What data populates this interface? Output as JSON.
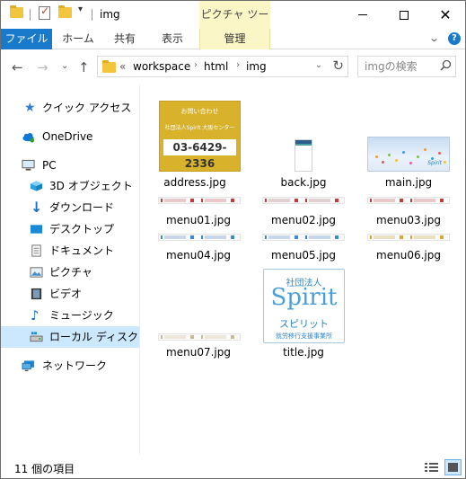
{
  "window": {
    "title": "img",
    "context_tab_header": "ピクチャ ツール"
  },
  "ribbon": {
    "tabs": [
      {
        "label": "ファイル"
      },
      {
        "label": "ホーム"
      },
      {
        "label": "共有"
      },
      {
        "label": "表示"
      },
      {
        "label": "管理"
      }
    ],
    "accent_color": "#1979ca",
    "context_color": "#fbf6c6"
  },
  "address": {
    "overflow": "«",
    "crumbs": [
      "workspace",
      "html",
      "img"
    ],
    "search_placeholder": "imgの検索"
  },
  "navpane": {
    "items": [
      {
        "label": "クイック アクセス",
        "icon": "star-icon"
      },
      {
        "label": "OneDrive",
        "icon": "cloud-icon"
      },
      {
        "label": "PC",
        "icon": "computer-icon"
      },
      {
        "label": "3D オブジェクト",
        "icon": "cube-icon"
      },
      {
        "label": "ダウンロード",
        "icon": "download-icon"
      },
      {
        "label": "デスクトップ",
        "icon": "desktop-icon"
      },
      {
        "label": "ドキュメント",
        "icon": "document-icon"
      },
      {
        "label": "ピクチャ",
        "icon": "picture-icon"
      },
      {
        "label": "ビデオ",
        "icon": "video-icon"
      },
      {
        "label": "ミュージック",
        "icon": "music-icon"
      },
      {
        "label": "ローカル ディスク (C:)",
        "icon": "drive-icon"
      },
      {
        "label": "ネットワーク",
        "icon": "network-icon"
      }
    ],
    "selected": "ローカル ディスク (C:)"
  },
  "files": [
    {
      "name": "address.jpg",
      "thumb_lines": [
        "お問い合わせ",
        "社団法人Spirit 大阪センター",
        "03-6429-2336"
      ]
    },
    {
      "name": "back.jpg"
    },
    {
      "name": "main.jpg"
    },
    {
      "name": "menu01.jpg"
    },
    {
      "name": "menu02.jpg"
    },
    {
      "name": "menu03.jpg"
    },
    {
      "name": "menu04.jpg"
    },
    {
      "name": "menu05.jpg"
    },
    {
      "name": "menu06.jpg"
    },
    {
      "name": "menu07.jpg"
    },
    {
      "name": "title.jpg",
      "thumb_lines": [
        "社団法人",
        "Spirit",
        "スピリット",
        "就労移行支援事業所"
      ]
    }
  ],
  "status": {
    "item_count": "11 個の項目"
  }
}
